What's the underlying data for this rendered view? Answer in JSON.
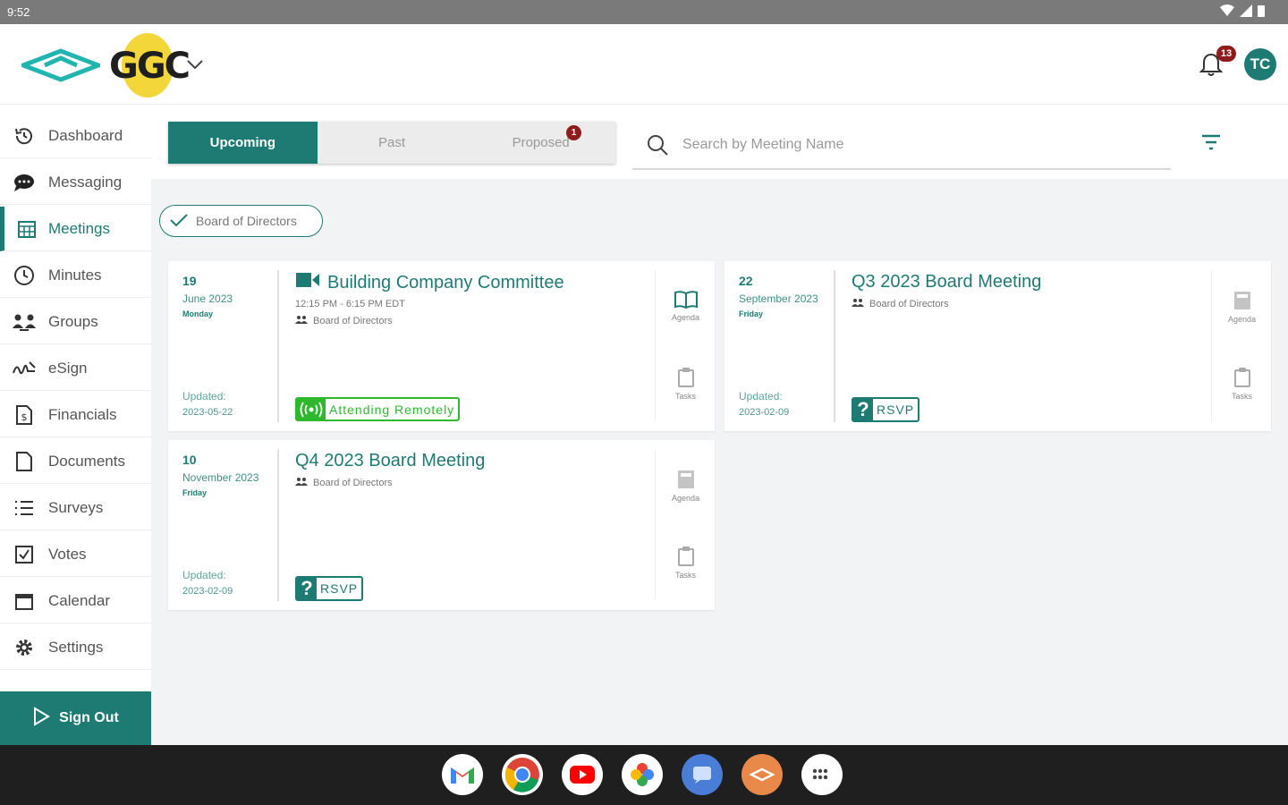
{
  "status_bar": {
    "time": "9:52"
  },
  "header": {
    "brand": "GGC",
    "notification_count": "13",
    "avatar_initials": "TC"
  },
  "sidebar": {
    "items": [
      {
        "label": "Dashboard",
        "icon": "history-icon"
      },
      {
        "label": "Messaging",
        "icon": "chat-icon"
      },
      {
        "label": "Meetings",
        "icon": "calendar-grid-icon"
      },
      {
        "label": "Minutes",
        "icon": "clock-icon"
      },
      {
        "label": "Groups",
        "icon": "groups-icon"
      },
      {
        "label": "eSign",
        "icon": "signature-icon"
      },
      {
        "label": "Financials",
        "icon": "dollar-doc-icon"
      },
      {
        "label": "Documents",
        "icon": "document-icon"
      },
      {
        "label": "Surveys",
        "icon": "list-icon"
      },
      {
        "label": "Votes",
        "icon": "checkbox-icon"
      },
      {
        "label": "Calendar",
        "icon": "calendar-icon"
      },
      {
        "label": "Settings",
        "icon": "gear-icon"
      }
    ],
    "active": "Meetings",
    "sign_out": "Sign Out"
  },
  "tabs": [
    {
      "label": "Upcoming"
    },
    {
      "label": "Past"
    },
    {
      "label": "Proposed",
      "badge": "1"
    }
  ],
  "search": {
    "placeholder": "Search by Meeting Name"
  },
  "filter_chip": "Board of Directors",
  "meetings": [
    {
      "day": "19",
      "month": "June 2023",
      "weekday": "Monday",
      "updated_label": "Updated:",
      "updated": "2023-05-22",
      "title": "Building Company Committee",
      "time": "12:15 PM - 6:15 PM EDT",
      "group": "Board of Directors",
      "status": "Attending Remotely",
      "agenda": "Agenda",
      "tasks": "Tasks"
    },
    {
      "day": "22",
      "month": "September 2023",
      "weekday": "Friday",
      "updated_label": "Updated:",
      "updated": "2023-02-09",
      "title": "Q3 2023 Board Meeting",
      "group": "Board of Directors",
      "status": "RSVP",
      "agenda": "Agenda",
      "tasks": "Tasks"
    },
    {
      "day": "10",
      "month": "November 2023",
      "weekday": "Friday",
      "updated_label": "Updated:",
      "updated": "2023-02-09",
      "title": "Q4 2023 Board Meeting",
      "group": "Board of Directors",
      "status": "RSVP",
      "agenda": "Agenda",
      "tasks": "Tasks"
    }
  ],
  "dock": [
    "gmail-icon",
    "chrome-icon",
    "youtube-icon",
    "photos-icon",
    "messages-icon",
    "ggc-app-icon",
    "app-drawer-icon"
  ],
  "colors": {
    "accent": "#1e7b74",
    "badge": "#8e1c1c",
    "attending": "#2eb82e",
    "logo_yellow": "#f3d639"
  }
}
